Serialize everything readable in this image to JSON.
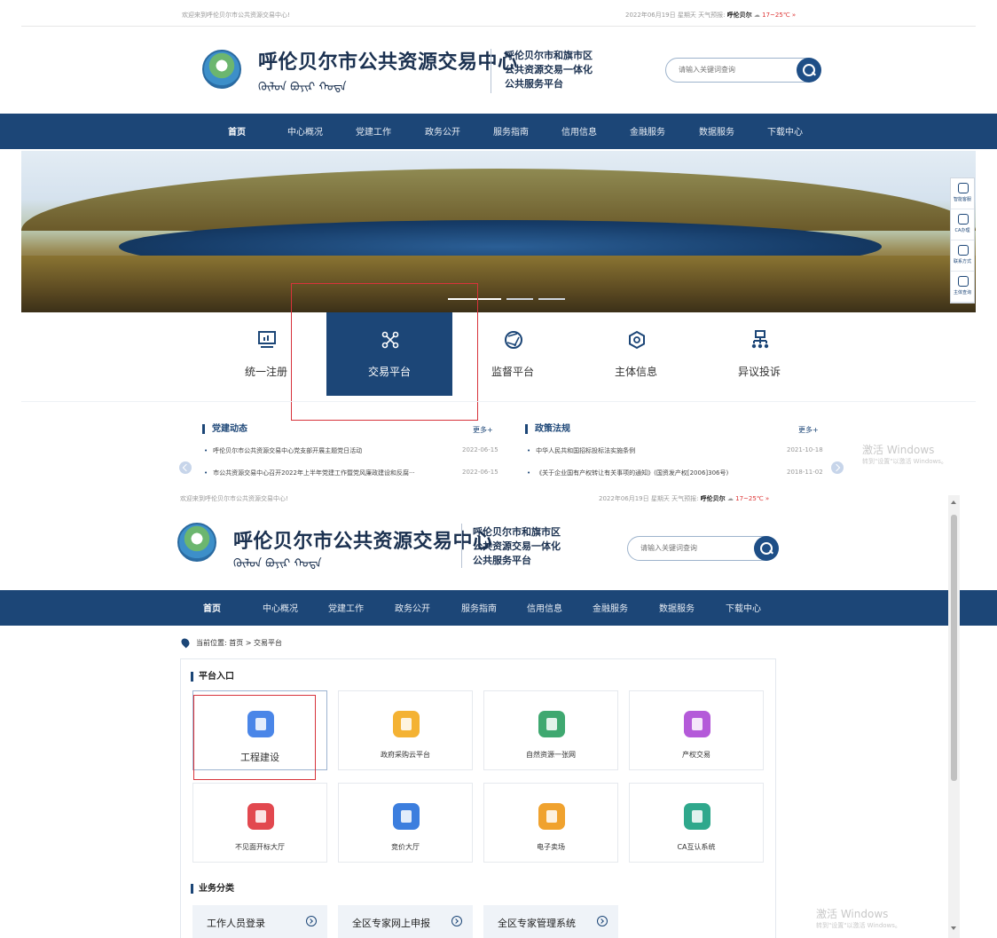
{
  "top_bar": {
    "welcome": "欢迎来到呼伦贝尔市公共资源交易中心!",
    "date_weather": "2022年06月19日 星期天 天气预报:",
    "city": "呼伦贝尔",
    "temp": "17~25℃ »"
  },
  "header": {
    "title": "呼伦贝尔市公共资源交易中心",
    "mongolian": "ᠬᠥᠯᠥᠨ ᠪᠤᠶᠢᠷ ᠬᠣᠲᠠ",
    "subtitle_1": "呼伦贝尔市和旗市区",
    "subtitle_2": "公共资源交易一体化",
    "subtitle_3": "公共服务平台",
    "search_placeholder": "请输入关键词查询"
  },
  "nav": [
    "首页",
    "中心概况",
    "党建工作",
    "政务公开",
    "服务指南",
    "信用信息",
    "金融服务",
    "数据服务",
    "下载中心"
  ],
  "side_tools": [
    "智能客服",
    "CA办理",
    "联系方式",
    "主体查询"
  ],
  "portals": [
    {
      "label": "统一注册",
      "icon": "monitor-chart-icon"
    },
    {
      "label": "交易平台",
      "icon": "network-nodes-icon"
    },
    {
      "label": "监督平台",
      "icon": "aperture-icon"
    },
    {
      "label": "主体信息",
      "icon": "hexagon-icon"
    },
    {
      "label": "异议投诉",
      "icon": "org-tree-icon"
    }
  ],
  "news_left": {
    "title": "党建动态",
    "more": "更多+",
    "items": [
      {
        "text": "呼伦贝尔市公共资源交易中心党支部开展主题党日活动",
        "date": "2022-06-15"
      },
      {
        "text": "市公共资源交易中心召开2022年上半年党建工作暨党风廉政建设和反腐···",
        "date": "2022-06-15"
      }
    ]
  },
  "news_right": {
    "title": "政策法规",
    "more": "更多+",
    "items": [
      {
        "text": "中华人民共和国招标投标法实施条例",
        "date": "2021-10-18"
      },
      {
        "text": "《关于企业国有产权转让有关事项的通知》(国资发产权[2006]306号)",
        "date": "2018-11-02"
      }
    ]
  },
  "watermark": {
    "title": "激活 Windows",
    "sub": "转到\"设置\"以激活 Windows。"
  },
  "breadcrumb": "当前位置: 首页 > 交易平台",
  "platform_section": "平台入口",
  "cards": [
    {
      "label": "工程建设",
      "color": "#4a86e8"
    },
    {
      "label": "政府采购云平台",
      "color": "#f4b233"
    },
    {
      "label": "自然资源一张网",
      "color": "#3fa870"
    },
    {
      "label": "产权交易",
      "color": "#b45ad9"
    },
    {
      "label": "不见面开标大厅",
      "color": "#e2484f"
    },
    {
      "label": "竞价大厅",
      "color": "#3c7ede"
    },
    {
      "label": "电子卖场",
      "color": "#f0a22e"
    },
    {
      "label": "CA互认系统",
      "color": "#2fa88c"
    }
  ],
  "business_section": "业务分类",
  "business": [
    "工作人员登录",
    "全区专家网上申报",
    "全区专家管理系统"
  ]
}
